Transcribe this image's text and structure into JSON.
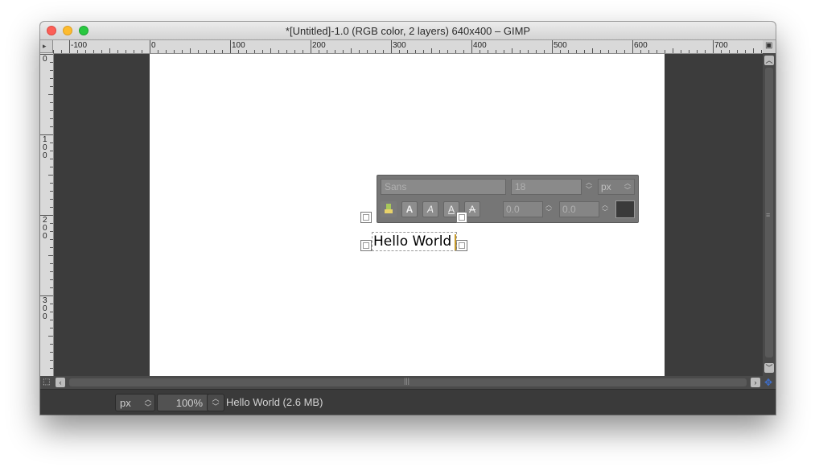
{
  "window": {
    "title": "*[Untitled]-1.0 (RGB color, 2 layers) 640x400 – GIMP"
  },
  "rulers": {
    "corner_icon": "▸",
    "nav_icon": "▣",
    "horizontal_labels": [
      "-100",
      "0",
      "100",
      "200",
      "300",
      "400",
      "500",
      "600",
      "700"
    ],
    "vertical_labels": [
      "0",
      "1\n0\n0",
      "2\n0\n0",
      "3\n0\n0"
    ]
  },
  "text_toolbox": {
    "font": "Sans",
    "size": "18",
    "unit": "px",
    "baseline": "0.0",
    "kerning": "0.0",
    "style_buttons": [
      "A",
      "A",
      "A",
      "A"
    ],
    "color": "#3a3a3a"
  },
  "canvas": {
    "text_layer": "Hello World"
  },
  "statusbar": {
    "unit": "px",
    "zoom": "100",
    "zoom_unit": "%",
    "info": "Hello World (2.6 MB)"
  },
  "colors": {
    "window_bg": "#3c3c3c",
    "image_bg": "#ffffff",
    "caret": "#c89a2a",
    "nav_accent": "#3d6fcf"
  }
}
